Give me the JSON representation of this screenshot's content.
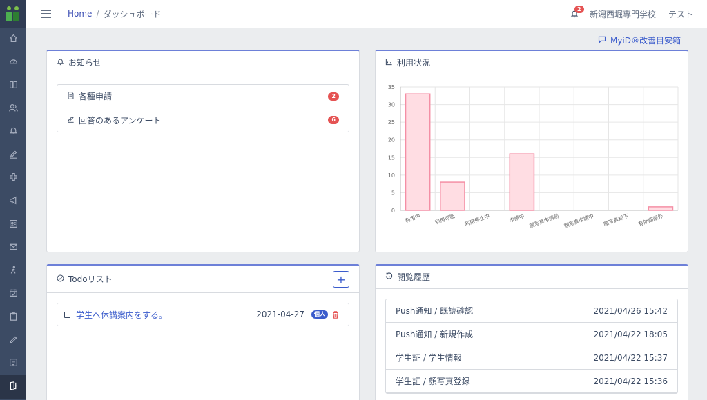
{
  "header": {
    "breadcrumb_home": "Home",
    "breadcrumb_sep": "/",
    "breadcrumb_current": "ダッシュボード",
    "notification_count": "2",
    "school_name": "新潟西堀専門学校",
    "user_name": "テスト"
  },
  "sidebar": {
    "items": [
      {
        "icon": "home-icon"
      },
      {
        "icon": "speedometer-icon"
      },
      {
        "icon": "book-icon"
      },
      {
        "icon": "people-icon"
      },
      {
        "icon": "bell-icon"
      },
      {
        "icon": "pencil-icon"
      },
      {
        "icon": "medical-cross-icon"
      },
      {
        "icon": "megaphone-icon"
      },
      {
        "icon": "id-card-icon"
      },
      {
        "icon": "envelope-icon"
      },
      {
        "icon": "walking-icon"
      },
      {
        "icon": "calendar-check-icon"
      },
      {
        "icon": "clipboard-icon"
      },
      {
        "icon": "pen-icon"
      },
      {
        "icon": "list-icon"
      },
      {
        "icon": "door-exit-icon"
      }
    ]
  },
  "myid_link": "MyiD®改善目安箱",
  "notice": {
    "title": "お知らせ",
    "items": [
      {
        "label": "各種申請",
        "count": "2"
      },
      {
        "label": "回答のあるアンケート",
        "count": "6"
      }
    ]
  },
  "usage": {
    "title": "利用状況"
  },
  "chart_data": {
    "type": "bar",
    "categories": [
      "利用中",
      "利用可能",
      "利用停止中",
      "申請中",
      "顔写真申請前",
      "顔写真申請中",
      "顔写真却下",
      "有効期限外"
    ],
    "values": [
      33,
      8,
      0,
      16,
      0,
      0,
      0,
      1
    ],
    "ylim": [
      0,
      35
    ],
    "yticks": [
      0,
      5,
      10,
      15,
      20,
      25,
      30,
      35
    ],
    "grid": true,
    "colors": {
      "fill": "#ffdde3",
      "stroke": "#f48fa5"
    }
  },
  "todo": {
    "title": "Todoリスト",
    "add_label": "+",
    "items": [
      {
        "text": "学生へ休講案内をする。",
        "date": "2021-04-27",
        "tag": "個人"
      }
    ]
  },
  "history": {
    "title": "閲覧履歴",
    "rows": [
      {
        "path": "Push通知 / 既読確認",
        "time": "2021/04/26 15:42"
      },
      {
        "path": "Push通知 / 新規作成",
        "time": "2021/04/22 18:05"
      },
      {
        "path": "学生証 / 学生情報",
        "time": "2021/04/22 15:37"
      },
      {
        "path": "学生証 / 顔写真登録",
        "time": "2021/04/22 15:36"
      }
    ]
  },
  "colors": {
    "sidebar": "#3c4b64",
    "accent": "#3b5ccc",
    "danger": "#e55353",
    "logo_green": "#5cb531",
    "logo_dark": "#2e7d32"
  }
}
